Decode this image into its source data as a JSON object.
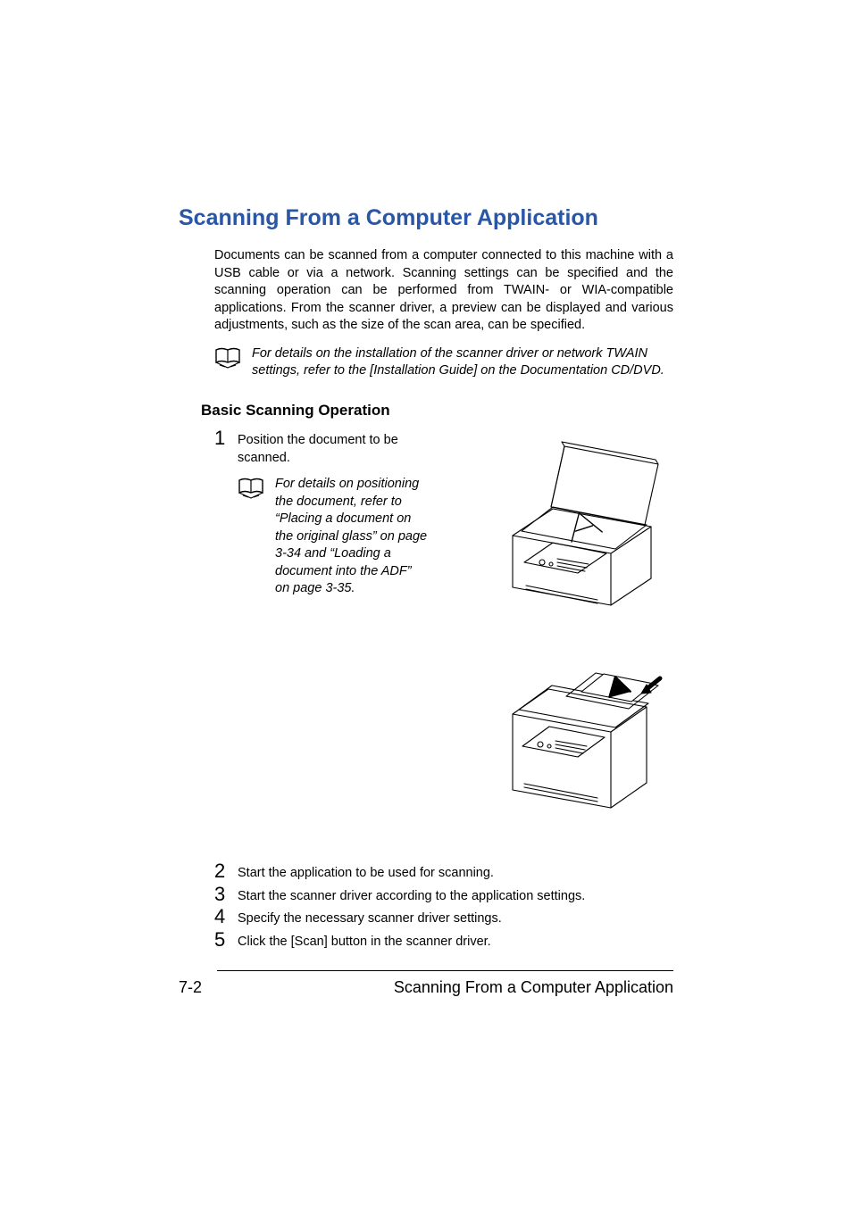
{
  "section_title": "Scanning From a Computer Application",
  "intro": "Documents can be scanned from a computer connected to this machine with a USB cable or via a network. Scanning settings can be specified and the scanning operation can be performed from TWAIN- or WIA-compatible applications. From the scanner driver, a preview can be displayed and various adjustments, such as the size of the scan area, can be specified.",
  "note1": "For details on the installation of the scanner driver or network TWAIN settings, refer to the [Installation Guide] on the Documentation CD/DVD.",
  "subheading": "Basic Scanning Operation",
  "steps": {
    "s1_num": "1",
    "s1_text": "Position the document to be scanned.",
    "s1_note": "For details on positioning the document, refer to “Placing a document on the original glass” on page 3-34 and “Loading a document into the ADF” on page 3-35.",
    "s2_num": "2",
    "s2_text": "Start the application to be used for scanning.",
    "s3_num": "3",
    "s3_text": "Start the scanner driver according to the application settings.",
    "s4_num": "4",
    "s4_text": "Specify the necessary scanner driver settings.",
    "s5_num": "5",
    "s5_text": "Click the [Scan] button in the scanner driver."
  },
  "footer": {
    "page": "7-2",
    "label": "Scanning From a Computer Application"
  }
}
